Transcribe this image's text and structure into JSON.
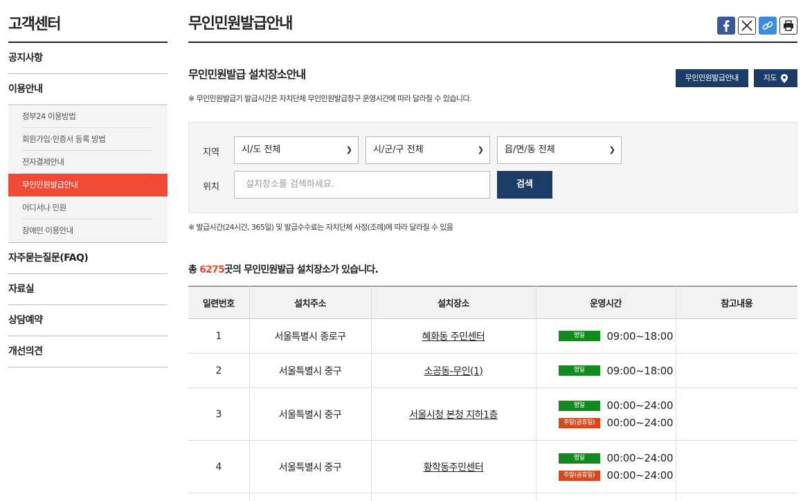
{
  "sidebar": {
    "title": "고객센터",
    "items": [
      {
        "label": "공지사항"
      },
      {
        "label": "이용안내"
      }
    ],
    "sub_items": [
      {
        "label": "정부24 이용방법",
        "active": false
      },
      {
        "label": "회원가입·인증서 등록 방법",
        "active": false
      },
      {
        "label": "전자결제안내",
        "active": false
      },
      {
        "label": "무인민원발급안내",
        "active": true
      },
      {
        "label": "어디서나 민원",
        "active": false
      },
      {
        "label": "장애인 이용안내",
        "active": false
      }
    ],
    "items_after": [
      {
        "label": "자주묻는질문(FAQ)"
      },
      {
        "label": "자료실"
      },
      {
        "label": "상담예약"
      },
      {
        "label": "개선의견"
      }
    ]
  },
  "page_title": "무인민원발급안내",
  "share_icons": [
    "facebook-icon",
    "x-icon",
    "link-icon",
    "print-icon"
  ],
  "section": {
    "title": "무인민원발급 설치장소안내",
    "btn_info": "무인민원발급안내",
    "btn_map": "지도",
    "note": "※ 무인민원발급기 발급시간은 자치단체 무인민원발급창구 운영시간에 따라 달라질 수 있습니다."
  },
  "search": {
    "region_label": "지역",
    "location_label": "위치",
    "select_sido": "시/도 전체",
    "select_sigungu": "시/군/구 전체",
    "select_eupmyeondong": "읍/면/동 전체",
    "placeholder": "설치장소를 검색하세요.",
    "button": "검색"
  },
  "note2": "※ 발급시간(24시간, 365일) 및 발급수수료는 자치단체 사정(조례)에 따라 달라질 수 있음",
  "total": {
    "prefix": "총 ",
    "count": "6275",
    "suffix": "곳의 무인민원발급 설치장소가 있습니다."
  },
  "table": {
    "headers": [
      "일련번호",
      "설치주소",
      "설치장소",
      "운영시간",
      "참고내용"
    ],
    "rows": [
      {
        "no": "1",
        "address": "서울특별시 종로구",
        "place": "혜화동 주민센터",
        "hours": [
          {
            "tag": "평일",
            "time": "09:00~18:00"
          }
        ],
        "note": ""
      },
      {
        "no": "2",
        "address": "서울특별시 중구",
        "place": "소공동-무인(1)",
        "hours": [
          {
            "tag": "평일",
            "time": "09:00~18:00"
          }
        ],
        "note": ""
      },
      {
        "no": "3",
        "address": "서울특별시 중구",
        "place": "서울시청 본청 지하1층",
        "hours": [
          {
            "tag": "평일",
            "time": "00:00~24:00"
          },
          {
            "tag": "주말(공휴일)",
            "time": "00:00~24:00"
          }
        ],
        "note": ""
      },
      {
        "no": "4",
        "address": "서울특별시 중구",
        "place": "황학동주민센터",
        "hours": [
          {
            "tag": "평일",
            "time": "00:00~24:00"
          },
          {
            "tag": "주말(공휴일)",
            "time": "00:00~24:00"
          }
        ],
        "note": ""
      }
    ]
  },
  "colors": {
    "accent": "#f04a37",
    "navy": "#1a3c66",
    "weekday": "#128a1f",
    "weekend": "#d44a1e"
  }
}
